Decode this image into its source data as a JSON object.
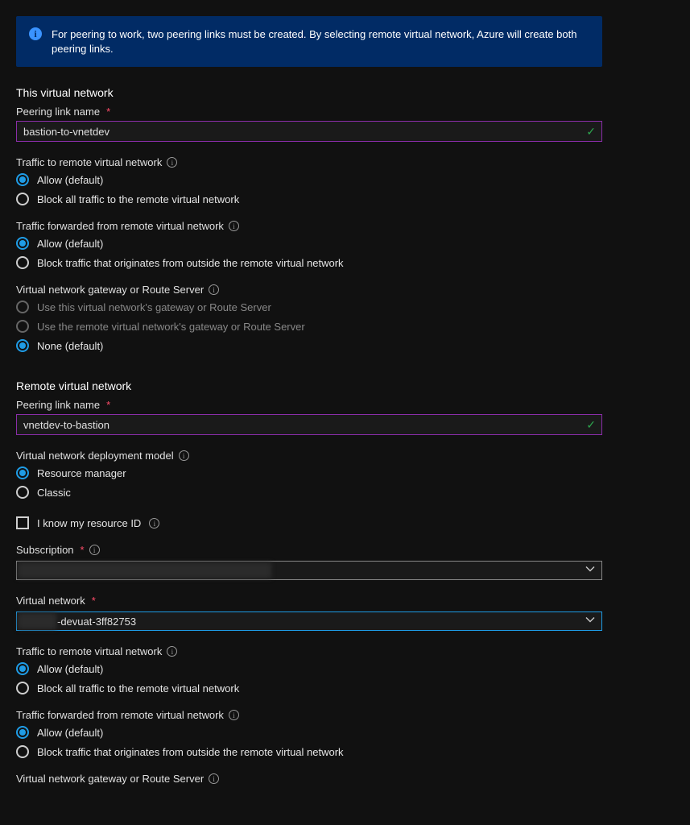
{
  "info_banner": "For peering to work, two peering links must be created. By selecting remote virtual network, Azure will create both peering links.",
  "this_vnet": {
    "title": "This virtual network",
    "peering_link_label": "Peering link name",
    "peering_link_value": "bastion-to-vnetdev",
    "traffic_to_label": "Traffic to remote virtual network",
    "traffic_to_opts": [
      "Allow (default)",
      "Block all traffic to the remote virtual network"
    ],
    "traffic_fwd_label": "Traffic forwarded from remote virtual network",
    "traffic_fwd_opts": [
      "Allow (default)",
      "Block traffic that originates from outside the remote virtual network"
    ],
    "gateway_label": "Virtual network gateway or Route Server",
    "gateway_opts": [
      "Use this virtual network's gateway or Route Server",
      "Use the remote virtual network's gateway or Route Server",
      "None (default)"
    ]
  },
  "remote_vnet": {
    "title": "Remote virtual network",
    "peering_link_label": "Peering link name",
    "peering_link_value": "vnetdev-to-bastion",
    "deploy_model_label": "Virtual network deployment model",
    "deploy_model_opts": [
      "Resource manager",
      "Classic"
    ],
    "know_resource_id": "I know my resource ID",
    "subscription_label": "Subscription",
    "subscription_value": "",
    "vnet_label": "Virtual network",
    "vnet_value": "-devuat-3ff82753",
    "traffic_to_label": "Traffic to remote virtual network",
    "traffic_to_opts": [
      "Allow (default)",
      "Block all traffic to the remote virtual network"
    ],
    "traffic_fwd_label": "Traffic forwarded from remote virtual network",
    "traffic_fwd_opts": [
      "Allow (default)",
      "Block traffic that originates from outside the remote virtual network"
    ],
    "gateway_label": "Virtual network gateway or Route Server"
  }
}
